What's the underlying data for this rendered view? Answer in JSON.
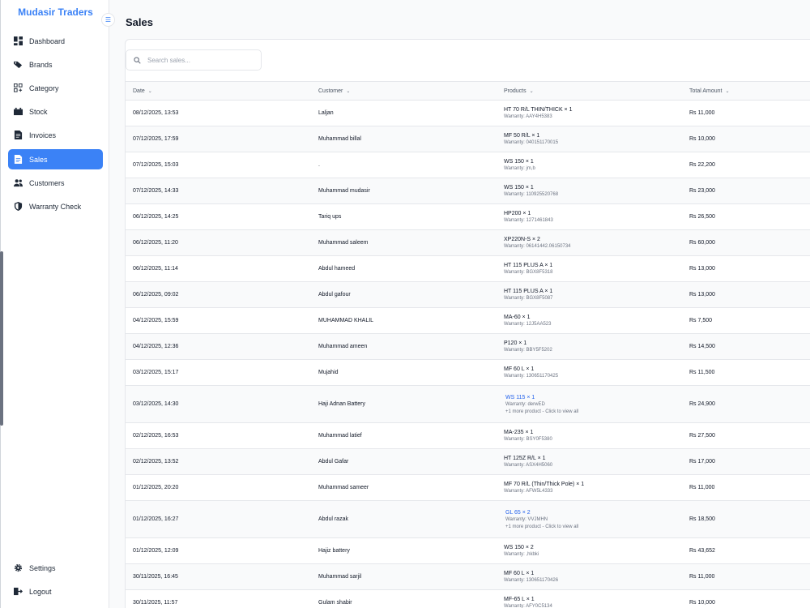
{
  "app": {
    "brand": "Mudasir Traders"
  },
  "sidebar": {
    "items": [
      {
        "label": "Dashboard",
        "icon": "dashboard-icon"
      },
      {
        "label": "Brands",
        "icon": "tag-icon"
      },
      {
        "label": "Category",
        "icon": "category-icon"
      },
      {
        "label": "Stock",
        "icon": "stock-icon"
      },
      {
        "label": "Invoices",
        "icon": "invoice-icon"
      },
      {
        "label": "Sales",
        "icon": "sales-icon",
        "active": true
      },
      {
        "label": "Customers",
        "icon": "customers-icon"
      },
      {
        "label": "Warranty Check",
        "icon": "shield-icon"
      }
    ],
    "bottom": [
      {
        "label": "Settings",
        "icon": "gear-icon"
      },
      {
        "label": "Logout",
        "icon": "logout-icon"
      }
    ]
  },
  "page": {
    "title": "Sales"
  },
  "search": {
    "placeholder": "Search sales..."
  },
  "table": {
    "columns": [
      "Date",
      "Customer",
      "Products",
      "Total Amount"
    ],
    "rows": [
      {
        "date": "08/12/2025, 13:53",
        "customer": "Laljan",
        "product": "HT 70 R/L THIN/THICK × 1",
        "warranty": "Warranty: AAY4H5383",
        "total": "Rs 11,000"
      },
      {
        "date": "07/12/2025, 17:59",
        "customer": "Muhammad billal",
        "product": "MF 50 R/L × 1",
        "warranty": "Warranty: 040151170015",
        "total": "Rs 10,000"
      },
      {
        "date": "07/12/2025, 15:03",
        "customer": ".",
        "product": "WS 150 × 1",
        "warranty": "Warranty: jm,b",
        "total": "Rs 22,200"
      },
      {
        "date": "07/12/2025, 14:33",
        "customer": "Muhammad mudasir",
        "product": "WS 150 × 1",
        "warranty": "Warranty: 110925520768",
        "total": "Rs 23,000"
      },
      {
        "date": "06/12/2025, 14:25",
        "customer": "Tariq ups",
        "product": "HP200 × 1",
        "warranty": "Warranty: 1271461843",
        "total": "Rs 26,500"
      },
      {
        "date": "06/12/2025, 11:20",
        "customer": "Muhammad saleem",
        "product": "XP220N-S × 2",
        "warranty": "Warranty: 06141442.06150734",
        "total": "Rs 60,000"
      },
      {
        "date": "06/12/2025, 11:14",
        "customer": "Abdul hameed",
        "product": "HT 115 PLUS A × 1",
        "warranty": "Warranty: BGX8F5318",
        "total": "Rs 13,000"
      },
      {
        "date": "06/12/2025, 09:02",
        "customer": "Abdul gafour",
        "product": "HT 115 PLUS A × 1",
        "warranty": "Warranty: BGX8F5087",
        "total": "Rs 13,000"
      },
      {
        "date": "04/12/2025, 15:59",
        "customer": "MUHAMMAD KHALIL",
        "product": "MA-60 × 1",
        "warranty": "Warranty: 12J5AA523",
        "total": "Rs 7,500"
      },
      {
        "date": "04/12/2025, 12:36",
        "customer": "Muhammad ameen",
        "product": "P120 × 1",
        "warranty": "Warranty: BBY5F5202",
        "total": "Rs 14,500"
      },
      {
        "date": "03/12/2025, 15:17",
        "customer": "Mujahid",
        "product": "MF 60 L × 1",
        "warranty": "Warranty: 130651170425",
        "total": "Rs 11,500"
      },
      {
        "date": "03/12/2025, 14:30",
        "customer": "Haji Adnan Battery",
        "product": "WS 115 × 1",
        "warranty": "Warranty: derwED",
        "more": "+1 more product - Click to view all",
        "total": "Rs 24,900"
      },
      {
        "date": "02/12/2025, 16:53",
        "customer": "Muhammad latief",
        "product": "MA-235 × 1",
        "warranty": "Warranty: BSY0F5380",
        "total": "Rs 27,500"
      },
      {
        "date": "02/12/2025, 13:52",
        "customer": "Abdul Gafar",
        "product": "HT 125Z R/L × 1",
        "warranty": "Warranty: ASX4H5060",
        "total": "Rs 17,000"
      },
      {
        "date": "01/12/2025, 20:20",
        "customer": "Muhammad sameer",
        "product": "MF 70 R/L (Thin/Thick Pole) × 1",
        "warranty": "Warranty: AFW5L4333",
        "total": "Rs 11,000"
      },
      {
        "date": "01/12/2025, 16:27",
        "customer": "Abdul razak",
        "product": "GL 65 × 2",
        "warranty": "Warranty: VVJMHN",
        "more": "+1 more product - Click to view all",
        "total": "Rs 18,500"
      },
      {
        "date": "01/12/2025, 12:09",
        "customer": "Hajiz battery",
        "product": "WS 150 × 2",
        "warranty": "Warranty: ,hkbki",
        "total": "Rs 43,652"
      },
      {
        "date": "30/11/2025, 16:45",
        "customer": "Muhammad sarjil",
        "product": "MF 60 L × 1",
        "warranty": "Warranty: 130651170426",
        "total": "Rs 11,000"
      },
      {
        "date": "30/11/2025, 11:57",
        "customer": "Gulam shabir",
        "product": "MF-65 L × 1",
        "warranty": "Warranty: AFY0C5134",
        "total": "Rs 10,000"
      }
    ]
  }
}
